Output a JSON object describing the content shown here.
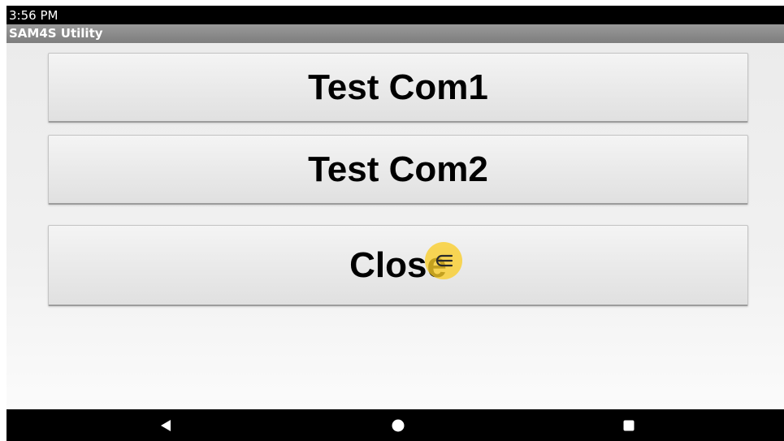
{
  "status_bar": {
    "time": "3:56 PM"
  },
  "app": {
    "title": "SAM4S Utility"
  },
  "buttons": {
    "test_com1": "Test Com1",
    "test_com2": "Test Com2",
    "close": "Close"
  },
  "nav_bar": {
    "icons": [
      "back-triangle",
      "home-circle",
      "recents-square"
    ]
  },
  "colors": {
    "status_bar": "#000000",
    "title_bar": "#8c8c8c",
    "button_face": "#e8e8e8",
    "touch_indicator": "#facd28"
  }
}
